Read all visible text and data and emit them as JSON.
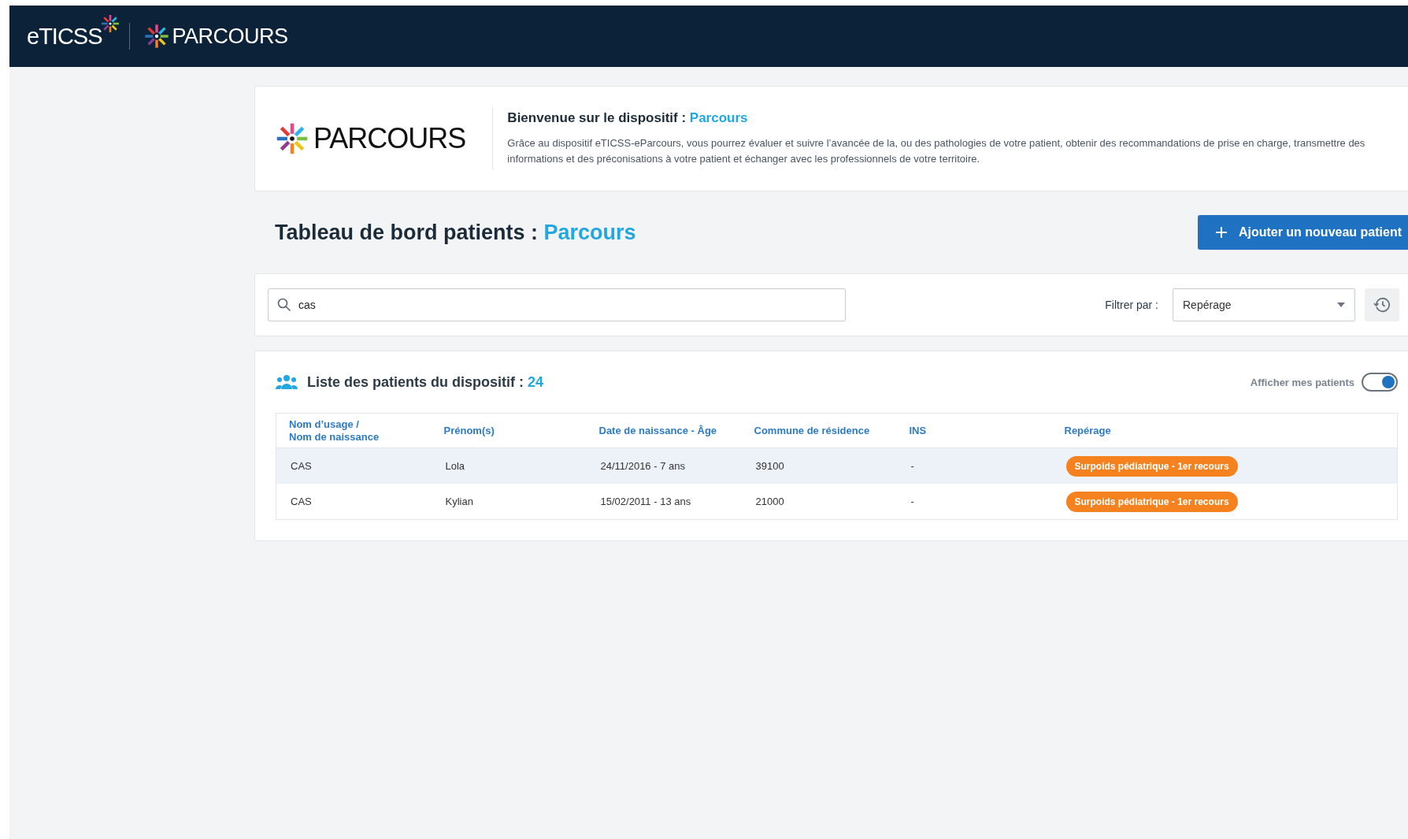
{
  "header": {
    "brand": "eTICSS",
    "product": "PARCOURS"
  },
  "welcome": {
    "logo_text": "PARCOURS",
    "title": "Bienvenue sur le dispositif :",
    "title_highlight": "Parcours",
    "description": "Grâce au dispositif eTICSS-eParcours, vous pourrez évaluer et suivre l’avancée de la, ou des pathologies de votre patient, obtenir des recommandations de prise en charge, transmettre des informations et des préconisations à votre patient et échanger avec les professionnels de votre territoire."
  },
  "dashboard": {
    "title": "Tableau de bord patients :",
    "title_highlight": "Parcours",
    "add_button": "Ajouter un nouveau patient"
  },
  "filters": {
    "search_value": "cas",
    "filter_label": "Filtrer par :",
    "filter_value": "Repérage"
  },
  "patient_list": {
    "title": "Liste des patients du dispositif :",
    "count": "24",
    "toggle_label": "Afficher mes patients",
    "toggle_on": true,
    "columns": [
      "Nom d’usage /\nNom de naissance",
      "Prénom(s)",
      "Date de naissance - Âge",
      "Commune de résidence",
      "INS",
      "Repérage"
    ],
    "rows": [
      {
        "selected": true,
        "cells": [
          "CAS",
          "Lola",
          "24/11/2016 - 7 ans",
          "39100",
          "-"
        ],
        "tag": "Surpoids pédiatrique - 1er recours",
        "color": "#f5821f"
      },
      {
        "selected": false,
        "cells": [
          "CAS",
          "Kylian",
          "15/02/2011 - 13 ans",
          "21000",
          "-"
        ],
        "tag": "Surpoids pédiatrique - 1er recours",
        "color": "#f5821f"
      }
    ]
  }
}
